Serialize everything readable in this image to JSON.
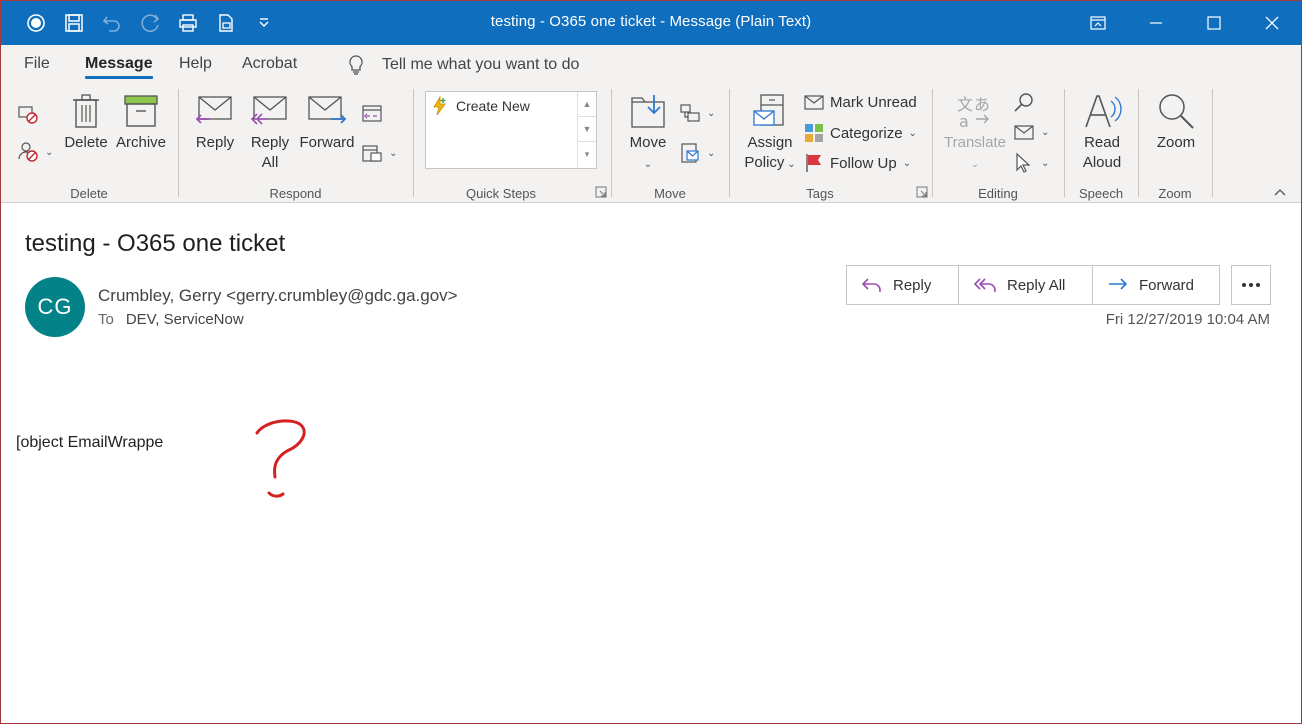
{
  "window": {
    "title": "testing - O365 one ticket  -  Message (Plain Text)",
    "accent_color": "#106ebe",
    "quick_access_icons": [
      "record-icon",
      "save-icon",
      "undo-icon",
      "redo-icon",
      "print-icon",
      "print-preview-icon",
      "customize-qat-icon"
    ],
    "window_buttons": [
      "restore-down-icon",
      "minimize-icon",
      "maximize-icon",
      "close-icon"
    ]
  },
  "tabs": {
    "file": "File",
    "message": "Message",
    "help": "Help",
    "acrobat": "Acrobat",
    "active": "Message"
  },
  "tell_me": {
    "text": "Tell me what you want to do"
  },
  "ribbon": {
    "delete_group": {
      "label": "Delete",
      "delete": "Delete",
      "archive": "Archive"
    },
    "respond_group": {
      "label": "Respond",
      "reply": "Reply",
      "reply_all_1": "Reply",
      "reply_all_2": "All",
      "forward": "Forward"
    },
    "quick_steps_group": {
      "label": "Quick Steps",
      "create_new": "Create New"
    },
    "move_group": {
      "label": "Move",
      "move": "Move"
    },
    "tags_group": {
      "label": "Tags",
      "assign_1": "Assign",
      "assign_2": "Policy",
      "mark_unread": "Mark Unread",
      "categorize": "Categorize",
      "follow_up": "Follow Up"
    },
    "editing_group": {
      "label": "Editing",
      "translate": "Translate"
    },
    "speech_group": {
      "label": "Speech",
      "read_1": "Read",
      "read_2": "Aloud"
    },
    "zoom_group": {
      "label": "Zoom",
      "zoom": "Zoom"
    }
  },
  "message": {
    "subject": "testing - O365 one ticket",
    "avatar_initials": "CG",
    "avatar_color": "#038387",
    "sender": "Crumbley, Gerry <gerry.crumbley@gdc.ga.gov>",
    "to_label": "To",
    "to_value": "DEV, ServiceNow",
    "date": "Fri 12/27/2019 10:04 AM",
    "actions": {
      "reply": "Reply",
      "reply_all": "Reply All",
      "forward": "Forward"
    },
    "body": "[object EmailWrappe",
    "annotation_color": "#d42020"
  }
}
